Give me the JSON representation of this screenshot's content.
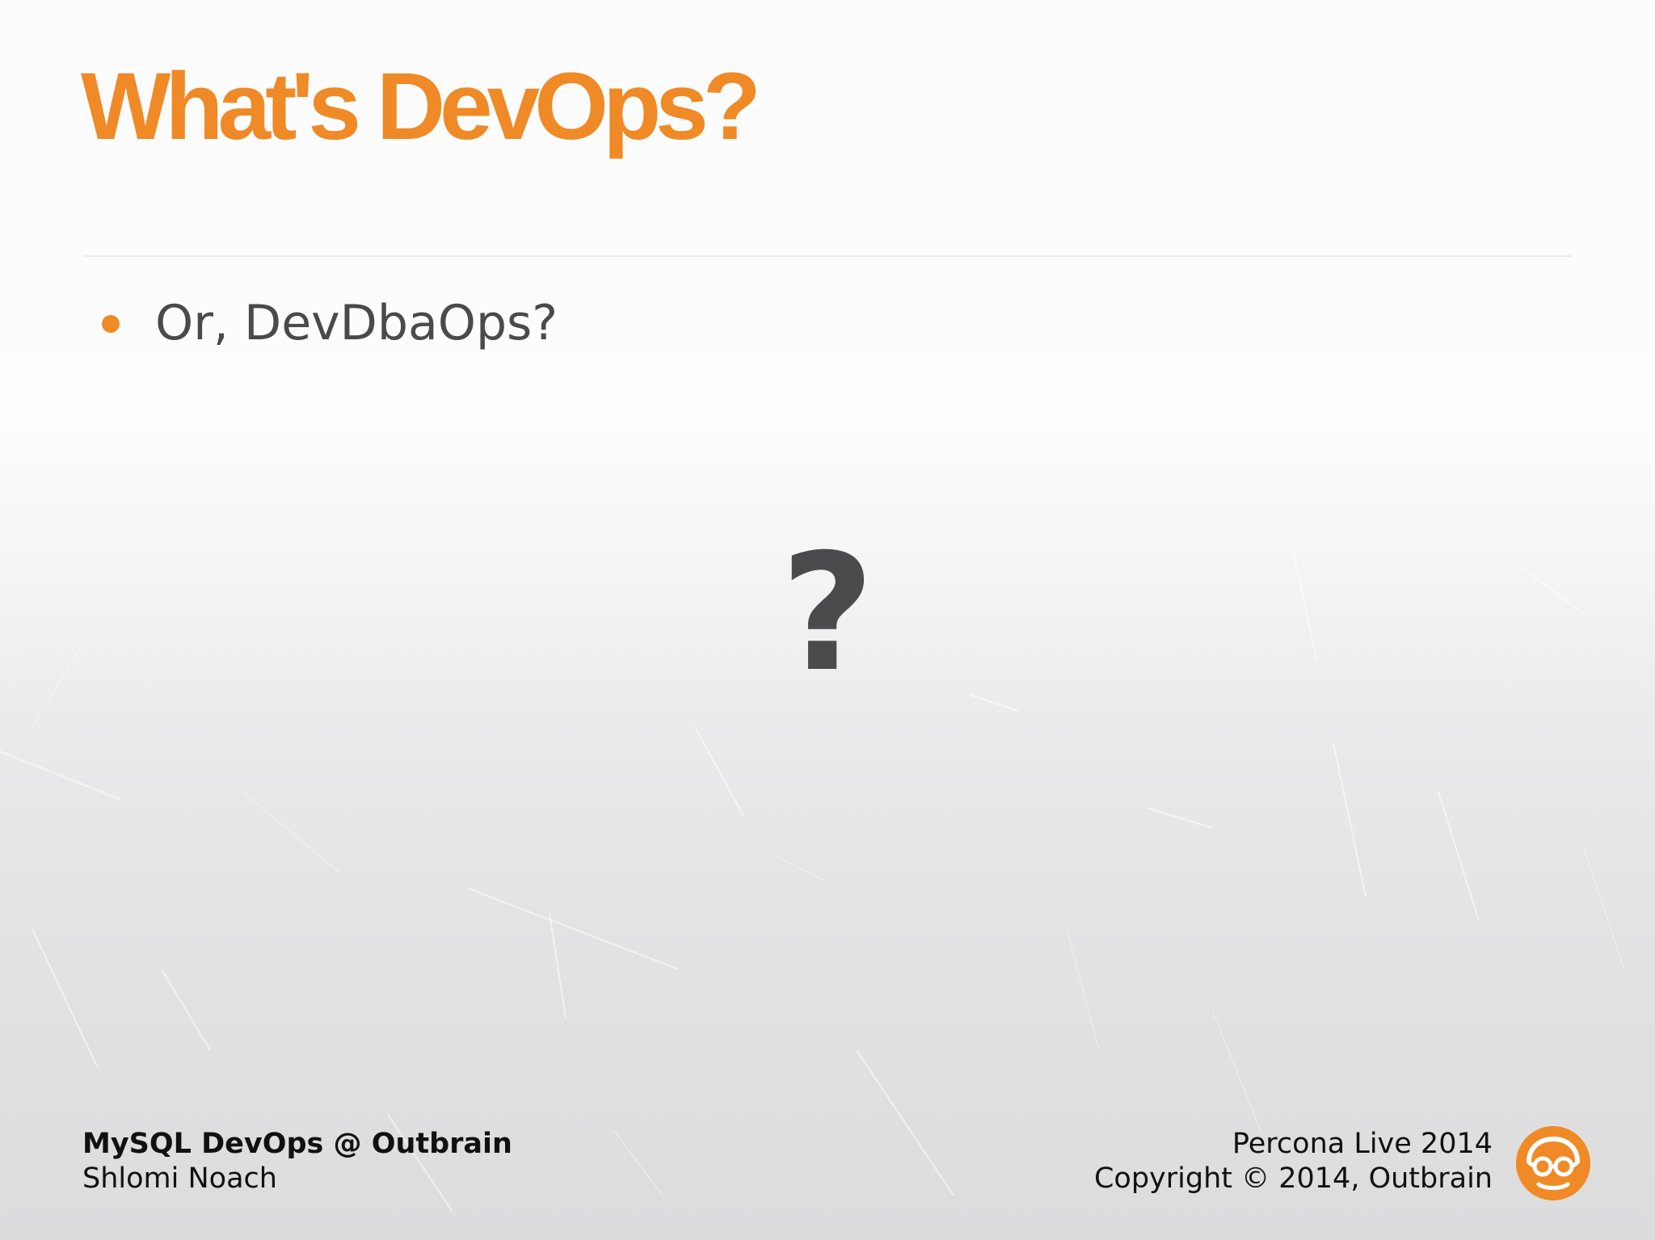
{
  "slide": {
    "title": "What's DevOps?",
    "bullets": [
      {
        "text": "Or, DevDbaOps?"
      }
    ],
    "center_mark": "?"
  },
  "footer": {
    "left_line1": "MySQL DevOps @ Outbrain",
    "left_line2": "Shlomi Noach",
    "right_line1": "Percona Live 2014",
    "right_line2": "Copyright © 2014, Outbrain"
  },
  "logo": {
    "icon": "outbrain-glasses-icon"
  },
  "colors": {
    "accent": "#ef8a26",
    "body_text": "#4a4a4c",
    "question_mark": "#4b4b4d",
    "footer_text": "#111111",
    "logo_bg": "#ef8a26"
  }
}
